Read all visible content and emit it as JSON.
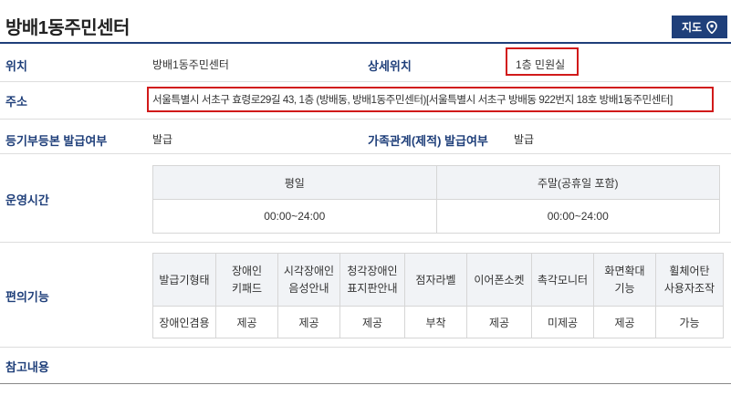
{
  "title": "방배1동주민센터",
  "map_button": {
    "label": "지도"
  },
  "location": {
    "label": "위치",
    "value": "방배1동주민센터"
  },
  "detail_location": {
    "label": "상세위치",
    "value": "1층 민원실"
  },
  "address": {
    "label": "주소",
    "value": "서울특별시 서초구 효령로29길 43, 1층 (방배동, 방배1동주민센터)[서울특별시 서초구 방배동 922번지 18호 방배1동주민센터]"
  },
  "registry": {
    "label": "등기부등본 발급여부",
    "value": "발급"
  },
  "family": {
    "label": "가족관계(제적) 발급여부",
    "value": "발급"
  },
  "hours": {
    "label": "운영시간",
    "headers": [
      "평일",
      "주말(공휴일 포함)"
    ],
    "values": [
      "00:00~24:00",
      "00:00~24:00"
    ]
  },
  "convenience": {
    "label": "편의기능",
    "headers": [
      [
        "발급기형태"
      ],
      [
        "장애인",
        "키패드"
      ],
      [
        "시각장애인",
        "음성안내"
      ],
      [
        "청각장애인",
        "표지판안내"
      ],
      [
        "점자라벨"
      ],
      [
        "이어폰소켓"
      ],
      [
        "촉각모니터"
      ],
      [
        "화면확대",
        "기능"
      ],
      [
        "휠체어탄",
        "사용자조작"
      ]
    ],
    "values": [
      "장애인겸용",
      "제공",
      "제공",
      "제공",
      "부착",
      "제공",
      "미제공",
      "제공",
      "가능"
    ]
  },
  "notes": {
    "label": "참고내용"
  },
  "colors": {
    "accent": "#1f3f7a",
    "highlight": "#d11a1a"
  }
}
